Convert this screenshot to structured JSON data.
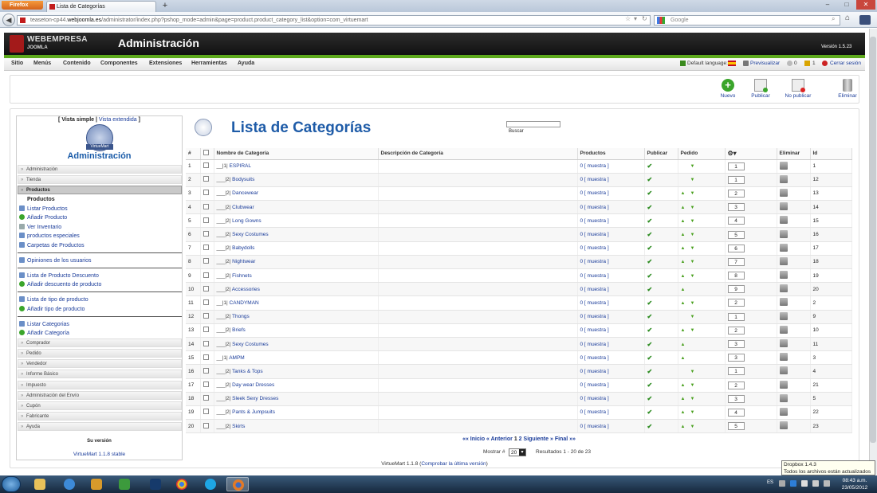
{
  "browser": {
    "menu_button": "Firefox",
    "tab_title": "Lista de Categorías",
    "url_prefix": "teaseton-cp44.",
    "url_domain": "webjoomla.es",
    "url_rest": "/administrator/index.php?pshop_mode=admin&page=product.product_category_list&option=com_virtuemart",
    "search_placeholder": "Google"
  },
  "header": {
    "brand_line1": "WEBEMPRESA",
    "brand_line2": "JOOMLA",
    "title": "Administración",
    "version": "Versión 1.5.23"
  },
  "menu": [
    "Sitio",
    "Menús",
    "Contenido",
    "Componentes",
    "Extensiones",
    "Herramientas",
    "Ayuda"
  ],
  "status": {
    "default_language": "Default language:",
    "preview": "Previsualizar",
    "messages": "0",
    "users": "1",
    "logout": "Cerrar sesión"
  },
  "toolbar": {
    "new": "Nuevo",
    "publish": "Publicar",
    "unpublish": "No publicar",
    "delete": "Eliminar"
  },
  "sidebar": {
    "simple_view": "[ Vista simple |",
    "extended_view": "Vista extendida",
    "close_bracket": "]",
    "logo_text": "VirtueMart",
    "title": "Administración",
    "sections_top": [
      "Administración",
      "Tienda"
    ],
    "open_section": "Productos",
    "products_header": "Productos",
    "product_links": [
      "Listar Productos",
      "Añadir Producto",
      "Ver Inventario",
      "productos especiales",
      "Carpetas de Productos"
    ],
    "reviews": "Opiniones de los usuarios",
    "discount_links": [
      "Lista de Producto Descuento",
      "Añadir descuento de producto"
    ],
    "type_links": [
      "Lista de tipo de producto",
      "Añadir tipo de producto"
    ],
    "category_links": [
      "Listar Categorias",
      "Añadir Categoría"
    ],
    "sections_bottom": [
      "Comprador",
      "Pedido",
      "Vendedor",
      "Informe Básico",
      "Impuesto",
      "Administración del Envío",
      "Cupón",
      "Fabricante",
      "Ayuda"
    ],
    "your_version": "Su versión",
    "vm_version": "VirtueMart 1.1.8 stable"
  },
  "main": {
    "title": "Lista de Categorías",
    "search_button": "Buscar",
    "columns": [
      "#",
      "",
      "Nombre de Categoría",
      "Descripción de Categoría",
      "Productos",
      "Publicar",
      "Pedido",
      "",
      "Eliminar",
      "Id"
    ],
    "rows": [
      {
        "n": "1",
        "prefix": "__|1|",
        "name": "ESPIRAL",
        "prod": "0 [ muestra ]",
        "up": false,
        "down": true,
        "order": "1",
        "id": "1"
      },
      {
        "n": "2",
        "prefix": "___|2|",
        "name": "Bodysuits",
        "prod": "0 [ muestra ]",
        "up": false,
        "down": true,
        "order": "1",
        "id": "12"
      },
      {
        "n": "3",
        "prefix": "___|2|",
        "name": "Dancewear",
        "prod": "0 [ muestra ]",
        "up": true,
        "down": true,
        "order": "2",
        "id": "13"
      },
      {
        "n": "4",
        "prefix": "___|2|",
        "name": "Clubwear",
        "prod": "0 [ muestra ]",
        "up": true,
        "down": true,
        "order": "3",
        "id": "14"
      },
      {
        "n": "5",
        "prefix": "___|2|",
        "name": "Long Gowns",
        "prod": "0 [ muestra ]",
        "up": true,
        "down": true,
        "order": "4",
        "id": "15"
      },
      {
        "n": "6",
        "prefix": "___|2|",
        "name": "Sexy Costumes",
        "prod": "0 [ muestra ]",
        "up": true,
        "down": true,
        "order": "5",
        "id": "16"
      },
      {
        "n": "7",
        "prefix": "___|2|",
        "name": "Babydolls",
        "prod": "0 [ muestra ]",
        "up": true,
        "down": true,
        "order": "6",
        "id": "17"
      },
      {
        "n": "8",
        "prefix": "___|2|",
        "name": "Nightwear",
        "prod": "0 [ muestra ]",
        "up": true,
        "down": true,
        "order": "7",
        "id": "18"
      },
      {
        "n": "9",
        "prefix": "___|2|",
        "name": "Fishnets",
        "prod": "0 [ muestra ]",
        "up": true,
        "down": true,
        "order": "8",
        "id": "19"
      },
      {
        "n": "10",
        "prefix": "___|2|",
        "name": "Accessories",
        "prod": "0 [ muestra ]",
        "up": true,
        "down": false,
        "order": "9",
        "id": "20"
      },
      {
        "n": "11",
        "prefix": "__|1|",
        "name": "CANDYMAN",
        "prod": "0 [ muestra ]",
        "up": true,
        "down": true,
        "order": "2",
        "id": "2"
      },
      {
        "n": "12",
        "prefix": "___|2|",
        "name": "Thongs",
        "prod": "0 [ muestra ]",
        "up": false,
        "down": true,
        "order": "1",
        "id": "9"
      },
      {
        "n": "13",
        "prefix": "___|2|",
        "name": "Briefs",
        "prod": "0 [ muestra ]",
        "up": true,
        "down": true,
        "order": "2",
        "id": "10"
      },
      {
        "n": "14",
        "prefix": "___|2|",
        "name": "Sexy Costumes",
        "prod": "0 [ muestra ]",
        "up": true,
        "down": false,
        "order": "3",
        "id": "11"
      },
      {
        "n": "15",
        "prefix": "__|1|",
        "name": "AMPM",
        "prod": "0 [ muestra ]",
        "up": true,
        "down": false,
        "order": "3",
        "id": "3"
      },
      {
        "n": "16",
        "prefix": "___|2|",
        "name": "Tanks & Tops",
        "prod": "0 [ muestra ]",
        "up": false,
        "down": true,
        "order": "1",
        "id": "4"
      },
      {
        "n": "17",
        "prefix": "___|2|",
        "name": "Day wear Dresses",
        "prod": "0 [ muestra ]",
        "up": true,
        "down": true,
        "order": "2",
        "id": "21"
      },
      {
        "n": "18",
        "prefix": "___|2|",
        "name": "Sleek Sexy Dresses",
        "prod": "0 [ muestra ]",
        "up": true,
        "down": true,
        "order": "3",
        "id": "5"
      },
      {
        "n": "19",
        "prefix": "___|2|",
        "name": "Pants & Jumpsuits",
        "prod": "0 [ muestra ]",
        "up": true,
        "down": true,
        "order": "4",
        "id": "22"
      },
      {
        "n": "20",
        "prefix": "___|2|",
        "name": "Skirts",
        "prod": "0 [ muestra ]",
        "up": true,
        "down": true,
        "order": "5",
        "id": "23"
      }
    ],
    "pager": {
      "start": "«« Inicio",
      "prev": "« Anterior",
      "p1": "1",
      "p2": "2",
      "next": "Siguiente »",
      "last": "Final »»"
    },
    "show_label": "Mostrar #",
    "show_value": "20",
    "results": "Resultados 1 - 20 de 23"
  },
  "footer": {
    "version": "VirtueMart 1.1.8",
    "check_link": "Comprobar la última versión"
  },
  "tooltip": {
    "title": "Dropbox 1.4.3",
    "text": "Todos los archivos están actualizados"
  },
  "taskbar": {
    "lang": "ES",
    "time": "08:43 a.m.",
    "date": "23/05/2012"
  },
  "colors": {
    "accent_blue": "#1f5ca8",
    "green_bar": "#5da91c",
    "firefox_orange": "#e37a26"
  }
}
